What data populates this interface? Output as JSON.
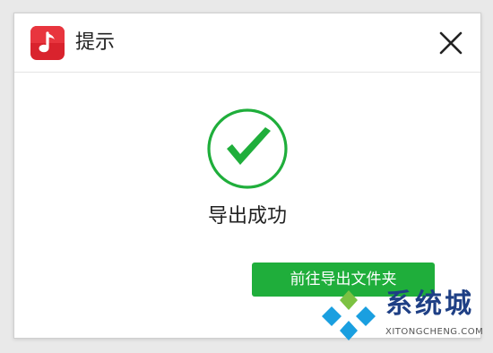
{
  "dialog": {
    "title": "提示",
    "message": "导出成功",
    "button_label": "前往导出文件夹"
  },
  "icons": {
    "app": "music-note-icon",
    "close": "close-icon",
    "success": "check-circle-icon"
  },
  "watermark": {
    "name_cn": "系统城",
    "name_en": "XITONGCHENG.COM"
  },
  "colors": {
    "success_green": "#1fae3b",
    "app_icon_red": "#d9232d",
    "watermark_blue": "#1e3f85",
    "watermark_cyan": "#1a9fe0"
  }
}
